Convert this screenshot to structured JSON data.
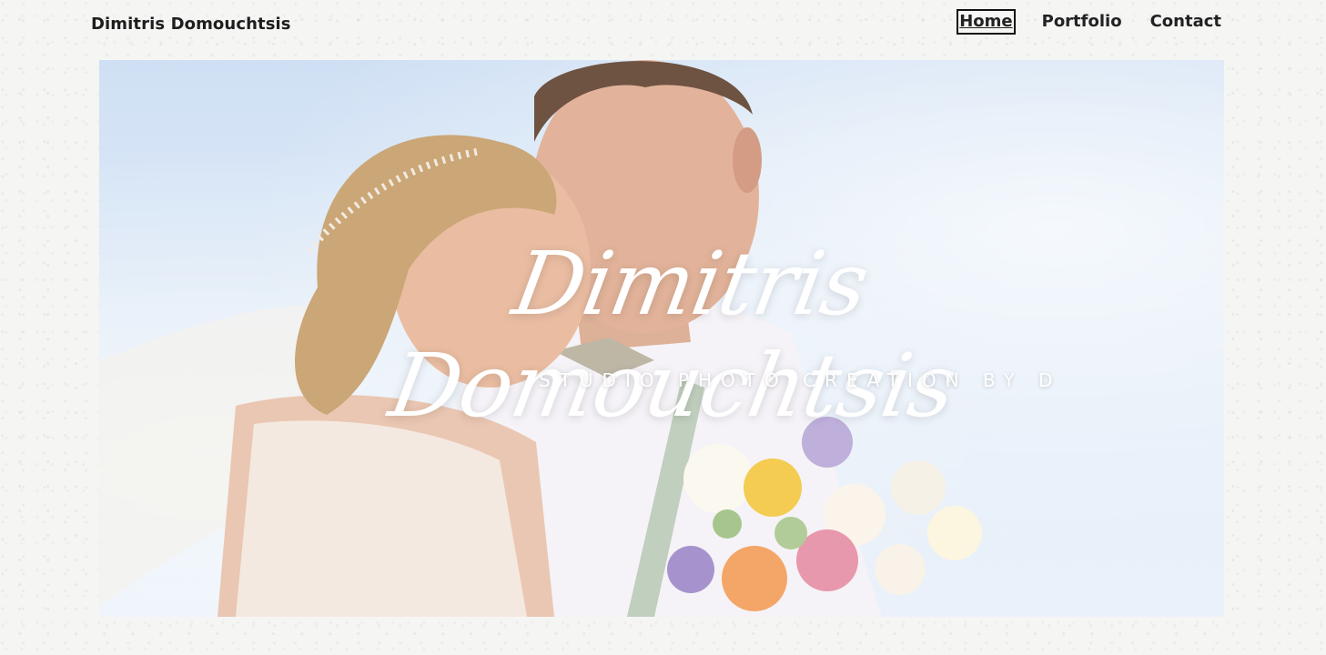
{
  "site": {
    "title": "Dimitris Domouchtsis"
  },
  "nav": {
    "items": [
      {
        "label": "Home",
        "active": true
      },
      {
        "label": "Portfolio",
        "active": false
      },
      {
        "label": "Contact",
        "active": false
      }
    ]
  },
  "hero": {
    "script_title": "Dimitris Domouchtsis",
    "tagline": "STUDIO PHOTO CREATION BY D",
    "image": "wedding-couple-photo"
  },
  "colors": {
    "background": "#f5f5f4",
    "text": "#222222",
    "hero_text": "#ffffff"
  }
}
